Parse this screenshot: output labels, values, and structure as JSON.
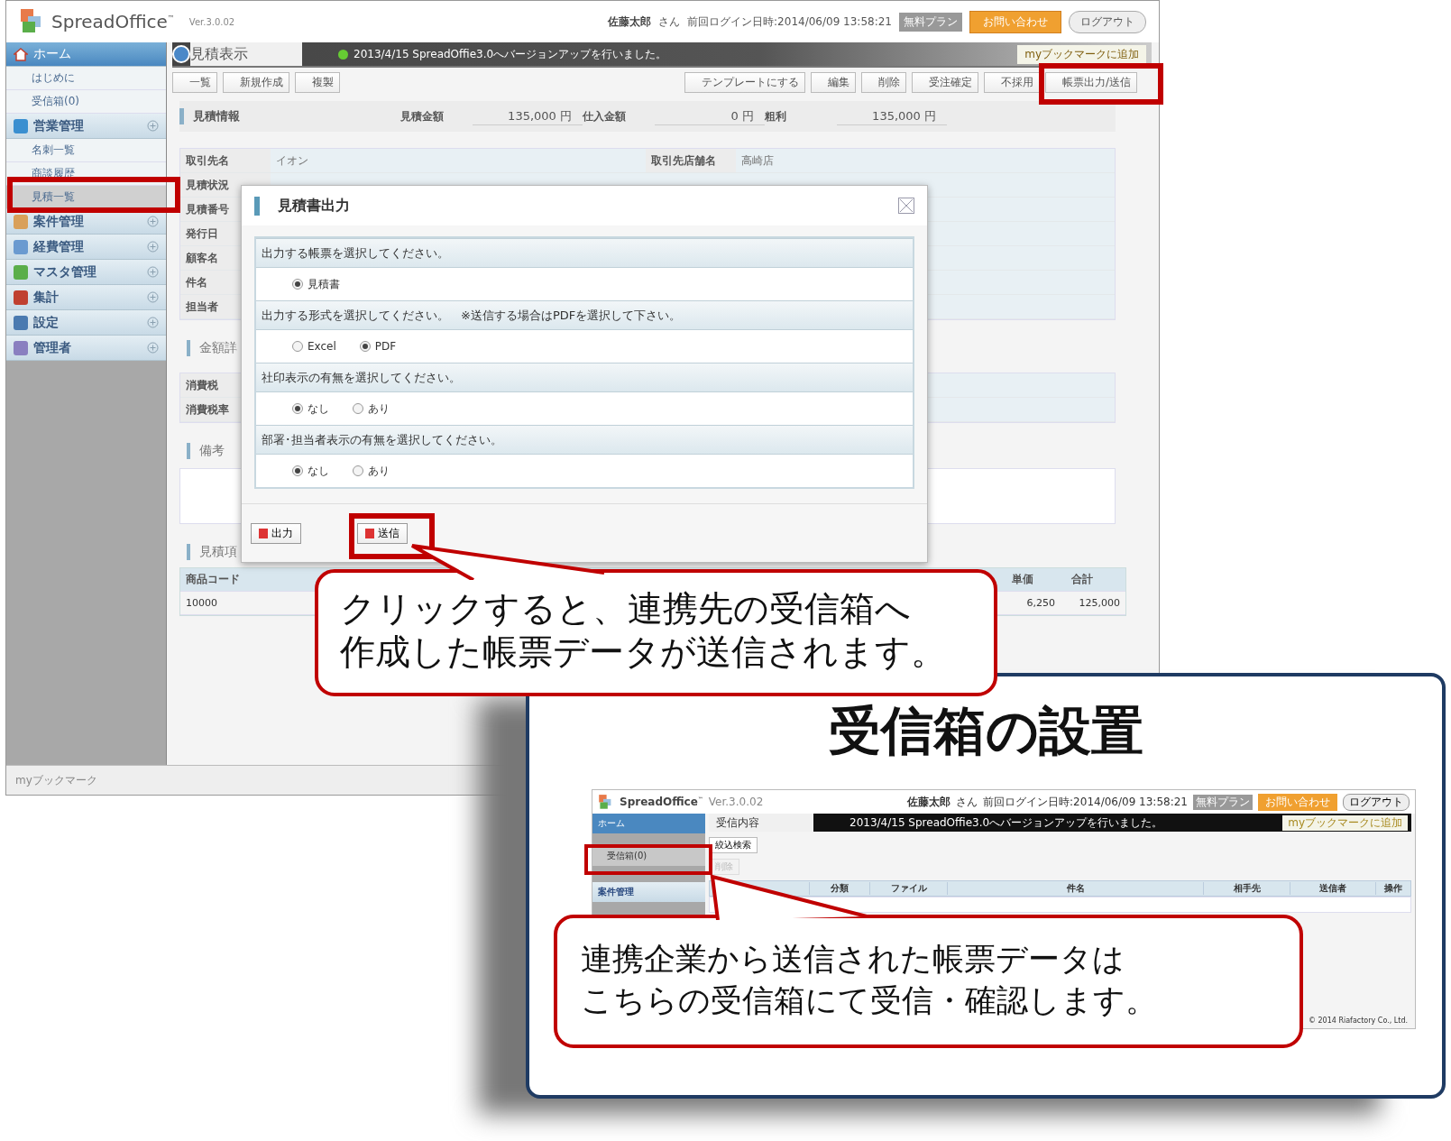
{
  "main_screen": {
    "header": {
      "logo": "SpreadOffice",
      "trademark": "™",
      "version": "Ver.3.0.02",
      "user_name": "佐藤太郎",
      "honorific": "さん",
      "last_login": "前回ログイン日時:2014/06/09 13:58:21",
      "plan_badge": "無料プラン",
      "contact_button": "お問い合わせ",
      "logout_button": "ログアウト"
    },
    "sidebar": {
      "items": [
        {
          "label": "ホーム",
          "kind": "home",
          "children": [
            {
              "label": "はじめに",
              "selected": false
            },
            {
              "label": "受信箱(0)",
              "selected": false
            }
          ]
        },
        {
          "label": "営業管理",
          "kind": "module",
          "children": [
            {
              "label": "名刺一覧",
              "selected": false
            },
            {
              "label": "商談履歴",
              "selected": false
            },
            {
              "label": "見積一覧",
              "selected": true
            }
          ]
        },
        {
          "label": "案件管理",
          "kind": "module"
        },
        {
          "label": "経費管理",
          "kind": "module"
        },
        {
          "label": "マスタ管理",
          "kind": "module"
        },
        {
          "label": "集計",
          "kind": "module"
        },
        {
          "label": "設定",
          "kind": "module"
        },
        {
          "label": "管理者",
          "kind": "module"
        }
      ],
      "footer": "myブックマーク"
    },
    "tab": "見積表示",
    "notice": "2013/4/15 SpreadOffie3.0へバージョンアップを行いました。",
    "bookmark_link": "myブックマークに追加",
    "toolbar_left": [
      "一覧",
      "新規作成",
      "複製"
    ],
    "toolbar_right": [
      "テンプレートにする",
      "編集",
      "削除",
      "受注確定",
      "不採用",
      "帳票出力/送信"
    ],
    "summary": {
      "title": "見積情報",
      "fields": [
        {
          "label": "見積金額",
          "value": "135,000",
          "unit": "円"
        },
        {
          "label": "仕入金額",
          "value": "0",
          "unit": "円"
        },
        {
          "label": "粗利",
          "value": "135,000",
          "unit": "円"
        }
      ]
    },
    "details": [
      {
        "label": "取引先名",
        "value": "イオン"
      },
      {
        "label": "取引先店舗名",
        "value": "高崎店"
      }
    ],
    "detail_labels": [
      "見積状況",
      "見積番号",
      "発行日",
      "顧客名",
      "件名",
      "担当者"
    ],
    "amount_section": {
      "title": "金額詳",
      "rows": [
        "消費税",
        "消費税率"
      ]
    },
    "remarks_section": {
      "title": "備考"
    },
    "items_section": {
      "title": "見積項",
      "columns": [
        "商品コード",
        "単価",
        "合計"
      ],
      "rows": [
        [
          "10000",
          "6,250",
          "125,000"
        ]
      ]
    }
  },
  "dialog": {
    "title": "見積書出力",
    "sections": [
      {
        "question": "出力する帳票を選択してください。",
        "options": [
          {
            "label": "見積書",
            "selected": true
          }
        ]
      },
      {
        "question": "出力する形式を選択してください。　※送信する場合はPDFを選択して下さい。",
        "options": [
          {
            "label": "Excel",
            "selected": false
          },
          {
            "label": "PDF",
            "selected": true
          }
        ]
      },
      {
        "question": "社印表示の有無を選択してください。",
        "options": [
          {
            "label": "なし",
            "selected": true
          },
          {
            "label": "あり",
            "selected": false
          }
        ]
      },
      {
        "question": "部署･担当者表示の有無を選択してください。",
        "options": [
          {
            "label": "なし",
            "selected": true
          },
          {
            "label": "あり",
            "selected": false
          }
        ]
      }
    ],
    "buttons": [
      "出力",
      "送信"
    ]
  },
  "callout_send": {
    "lines": [
      "クリックすると、連携先の受信箱へ",
      "作成した帳票データが送信されます。"
    ]
  },
  "inbox_panel": {
    "title": "受信箱の設置",
    "screenshot": {
      "logo": "SpreadOffice",
      "trademark": "™",
      "version": "Ver.3.0.02",
      "user_name": "佐藤太郎",
      "honorific": "さん",
      "last_login": "前回ログイン日時:2014/06/09 13:58:21",
      "plan_badge": "無料プラン",
      "contact_button": "お問い合わせ",
      "logout_button": "ログアウト",
      "sidebar": [
        {
          "label": "ホーム",
          "kind": "home",
          "selected": false
        },
        {
          "label": "受信箱(0)",
          "kind": "sub",
          "selected": true
        },
        {
          "label": "案件管理",
          "kind": "module",
          "selected": false
        }
      ],
      "tab": "受信内容",
      "notice": "2013/4/15 SpreadOffie3.0へバージョンアップを行いました。",
      "bookmark_link": "myブックマークに追加",
      "buttons": [
        {
          "label": "絞込検索",
          "disabled": false
        },
        {
          "label": "削除",
          "disabled": true
        }
      ],
      "columns": [
        "分類",
        "ファイル",
        "件名",
        "相手先",
        "送信者",
        "操作"
      ],
      "copyright": "© 2014 Riafactory Co., Ltd."
    },
    "callout": {
      "lines": [
        "連携企業から送信された帳票データは",
        "こちらの受信箱にて受信・確認します。"
      ]
    }
  }
}
